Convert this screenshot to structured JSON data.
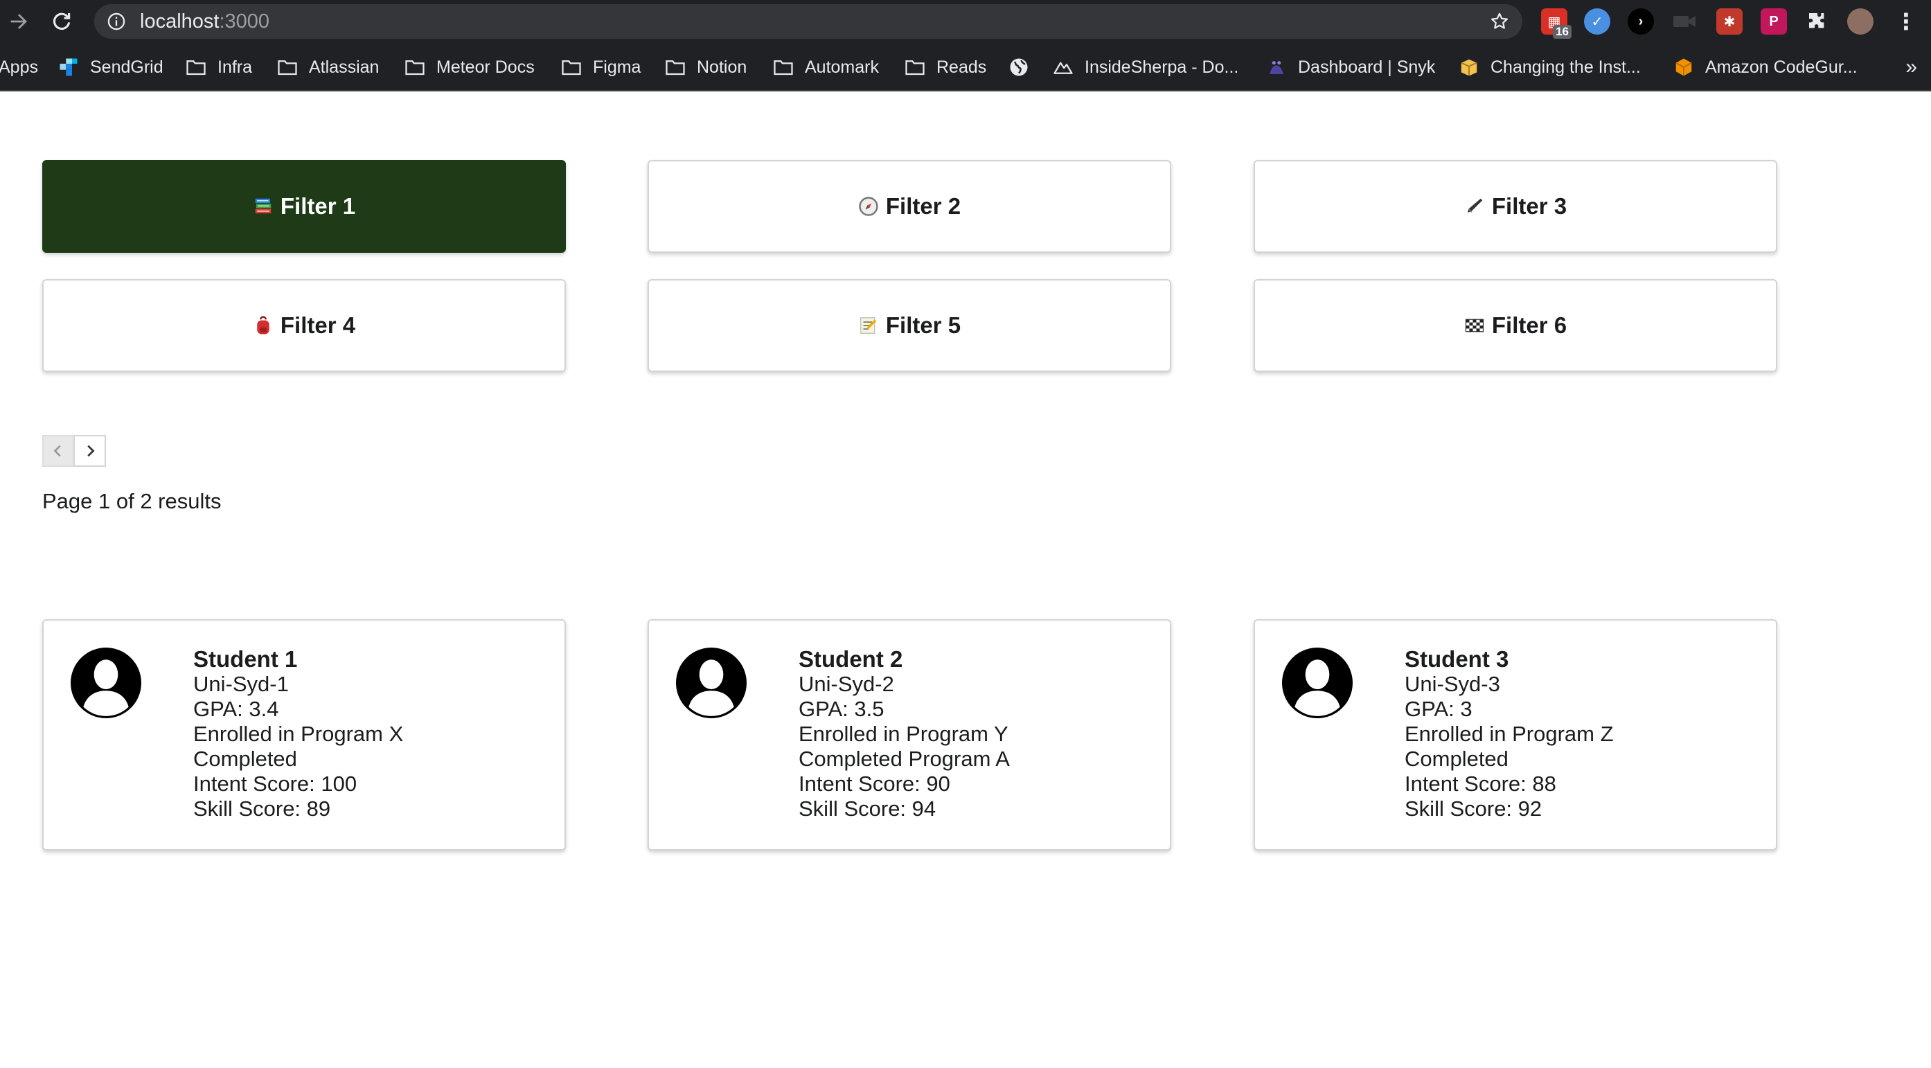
{
  "browser": {
    "url_host": "localhost",
    "url_port": ":3000",
    "extension_badge": "16",
    "bookmarks": [
      {
        "label": "Apps",
        "icon": "apps-grid-icon"
      },
      {
        "label": "SendGrid",
        "icon": "sendgrid-icon"
      },
      {
        "label": "Infra",
        "icon": "folder-icon"
      },
      {
        "label": "Atlassian",
        "icon": "folder-icon"
      },
      {
        "label": "Meteor Docs",
        "icon": "folder-icon"
      },
      {
        "label": "Figma",
        "icon": "folder-icon"
      },
      {
        "label": "Notion",
        "icon": "folder-icon"
      },
      {
        "label": "Automark",
        "icon": "folder-icon"
      },
      {
        "label": "Reads",
        "icon": "folder-icon"
      },
      {
        "label": "",
        "icon": "globe-icon"
      },
      {
        "label": "InsideSherpa - Do...",
        "icon": "mountain-icon"
      },
      {
        "label": "Dashboard | Snyk",
        "icon": "snyk-icon"
      },
      {
        "label": "Changing the Inst...",
        "icon": "box-icon"
      },
      {
        "label": "Amazon CodeGur...",
        "icon": "cube-icon"
      }
    ],
    "overflow": "»"
  },
  "filters": [
    {
      "label": "Filter 1",
      "icon": "books-icon",
      "active": true
    },
    {
      "label": "Filter 2",
      "icon": "compass-icon",
      "active": false
    },
    {
      "label": "Filter 3",
      "icon": "pen-icon",
      "active": false
    },
    {
      "label": "Filter 4",
      "icon": "backpack-icon",
      "active": false
    },
    {
      "label": "Filter 5",
      "icon": "memo-icon",
      "active": false
    },
    {
      "label": "Filter 6",
      "icon": "checkered-flag-icon",
      "active": false
    }
  ],
  "pagination": {
    "summary": "Page 1 of 2 results",
    "current_page": 1,
    "total_pages": 2
  },
  "students": [
    {
      "name": "Student 1",
      "id": "Uni-Syd-1",
      "gpa": "GPA: 3.4",
      "enrolled": "Enrolled in Program X",
      "completed": "Completed",
      "intent": "Intent Score: 100",
      "skill": "Skill Score: 89"
    },
    {
      "name": "Student 2",
      "id": "Uni-Syd-2",
      "gpa": "GPA: 3.5",
      "enrolled": "Enrolled in Program Y",
      "completed": "Completed Program A",
      "intent": "Intent Score: 90",
      "skill": "Skill Score: 94"
    },
    {
      "name": "Student 3",
      "id": "Uni-Syd-3",
      "gpa": "GPA: 3",
      "enrolled": "Enrolled in Program Z",
      "completed": "Completed",
      "intent": "Intent Score: 88",
      "skill": "Skill Score: 92"
    }
  ],
  "colors": {
    "active_filter": "#1e3a16",
    "chrome_bg": "#202124",
    "omnibox_bg": "#35363a"
  }
}
